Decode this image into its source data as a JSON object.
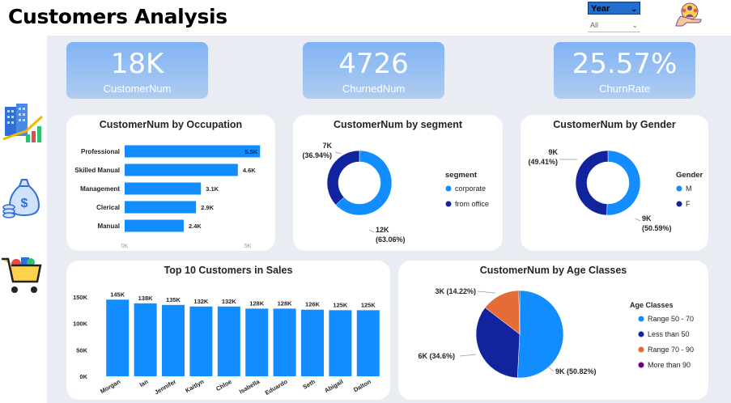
{
  "header": {
    "title": "Customers Analysis",
    "slicer_label": "Year",
    "slicer_value": "All"
  },
  "kpis": [
    {
      "value": "18K",
      "label": "CustomerNum"
    },
    {
      "value": "4726",
      "label": "ChurnedNum"
    },
    {
      "value": "25.57%",
      "label": "ChurnRate"
    }
  ],
  "colors": {
    "blue": "#118dff",
    "dark_blue": "#12239e",
    "orange": "#e66c37",
    "purple": "#6b007b"
  },
  "icons": [
    "users-hand-icon",
    "buildings-chart-icon",
    "money-bag-icon",
    "shopping-cart-icon"
  ],
  "chart_data": [
    {
      "type": "bar",
      "orientation": "horizontal",
      "title": "CustomerNum by Occupation",
      "categories": [
        "Professional",
        "Skilled Manual",
        "Management",
        "Clerical",
        "Manual"
      ],
      "values": [
        5500,
        4600,
        3100,
        2900,
        2400
      ],
      "data_labels": [
        "5.5K",
        "4.6K",
        "3.1K",
        "2.9K",
        "2.4K"
      ],
      "xticks": [
        "0K",
        "5K"
      ],
      "xlim": [
        0,
        5000
      ]
    },
    {
      "type": "pie",
      "donut": true,
      "title": "CustomerNum by segment",
      "legend_title": "segment",
      "labels": [
        "corporate",
        "from office"
      ],
      "values": [
        12000,
        7000
      ],
      "percents": [
        63.06,
        36.94
      ],
      "data_labels": [
        [
          "12K",
          "(63.06%)"
        ],
        [
          "7K",
          "(36.94%)"
        ]
      ]
    },
    {
      "type": "pie",
      "donut": true,
      "title": "CustomerNum by Gender",
      "legend_title": "Gender",
      "labels": [
        "M",
        "F"
      ],
      "values": [
        9000,
        9000
      ],
      "percents": [
        50.59,
        49.41
      ],
      "data_labels": [
        [
          "9K",
          "(50.59%)"
        ],
        [
          "9K",
          "(49.41%)"
        ]
      ]
    },
    {
      "type": "bar",
      "title": "Top 10 Customers in Sales",
      "categories": [
        "Morgan",
        "Ian",
        "Jennifer",
        "Kaitlyn",
        "Chloe",
        "Isabella",
        "Eduardo",
        "Seth",
        "Abigail",
        "Dalton"
      ],
      "values": [
        145000,
        138000,
        135000,
        132000,
        132000,
        128000,
        128000,
        126000,
        125000,
        125000
      ],
      "data_labels": [
        "145K",
        "138K",
        "135K",
        "132K",
        "132K",
        "128K",
        "128K",
        "126K",
        "125K",
        "125K"
      ],
      "yticks": [
        "0K",
        "50K",
        "100K",
        "150K"
      ],
      "ylim": [
        0,
        150000
      ]
    },
    {
      "type": "pie",
      "title": "CustomerNum by Age Classes",
      "legend_title": "Age Classes",
      "labels": [
        "Range 50 - 70",
        "Less than 50",
        "Range 70 - 90",
        "More than 90"
      ],
      "percents": [
        50.82,
        34.6,
        14.22,
        0.36
      ],
      "data_labels": [
        "9K (50.82%)",
        "6K (34.6%)",
        "3K (14.22%)",
        ""
      ]
    }
  ]
}
